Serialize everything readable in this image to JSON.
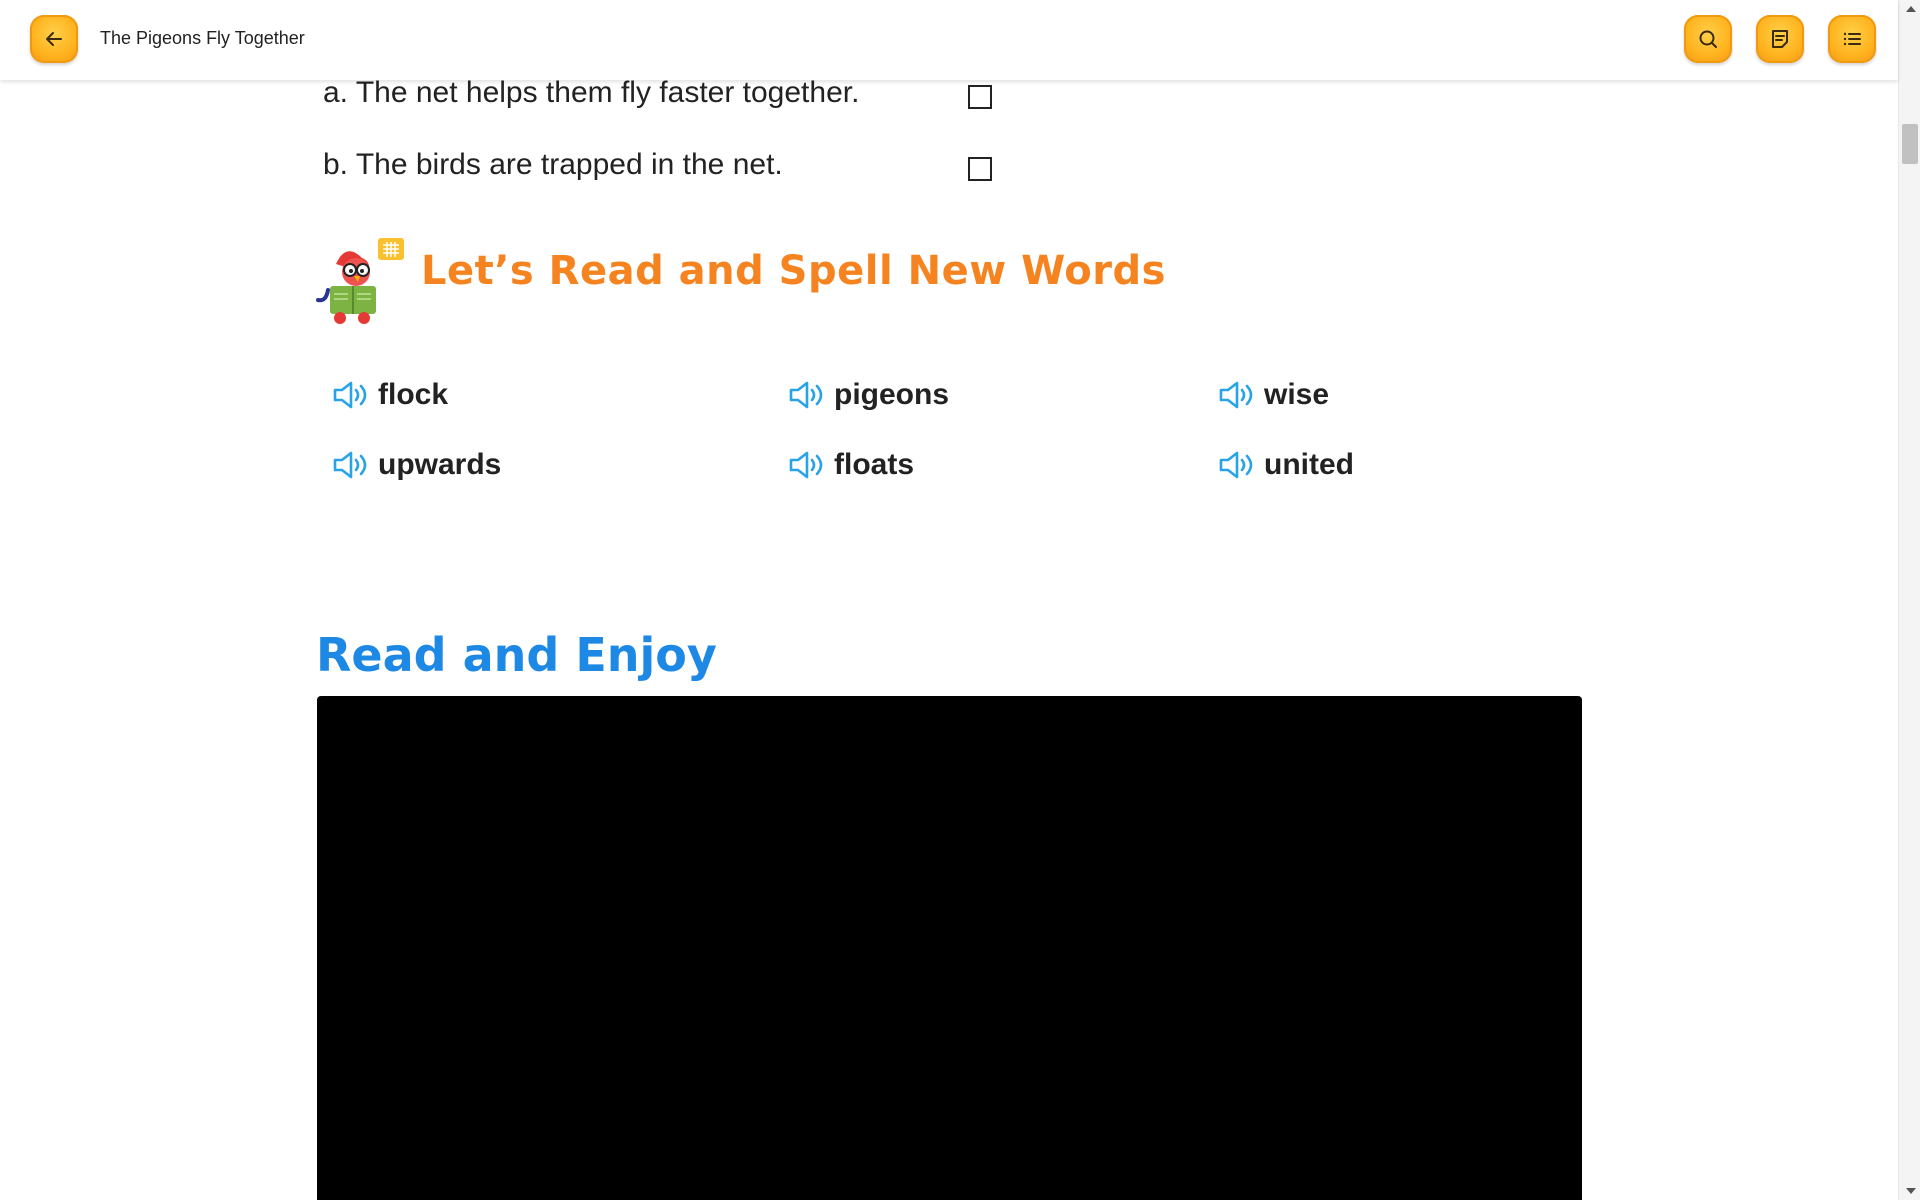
{
  "header": {
    "title": "The Pigeons Fly Together",
    "back_icon": "arrow-left-icon",
    "search_icon": "search-icon",
    "notes_icon": "notes-icon",
    "menu_icon": "list-menu-icon",
    "accent_color": "#ffb21d"
  },
  "quiz": {
    "options": [
      {
        "label": "a. The net helps them fly faster together.",
        "checked": false
      },
      {
        "label": "b. The birds are trapped in the net.",
        "checked": false
      }
    ]
  },
  "new_words": {
    "heading": "Let’s Read and Spell New Words",
    "heading_color": "#f5831f",
    "mascot_icon": "reading-bird-mascot-icon",
    "speaker_icon": "speaker-icon",
    "words": [
      "flock",
      "pigeons",
      "wise",
      "upwards",
      "floats",
      "united"
    ]
  },
  "read_and_enjoy": {
    "heading": "Read and Enjoy",
    "heading_color": "#1e88e5"
  }
}
